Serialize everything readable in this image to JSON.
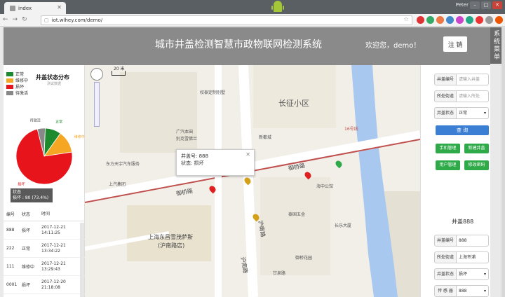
{
  "browser": {
    "tab_title": "index",
    "url": "iot.wlhey.com/demo/",
    "user": "Peter"
  },
  "header": {
    "title": "城市井盖检测智慧市政物联网检测系统",
    "welcome": "欢迎您，demo！",
    "logout_label": "注 销",
    "sys_menu": "系统菜单"
  },
  "status_chart": {
    "title": "井盖状态分布",
    "subtitle": "测试数据",
    "legend": [
      {
        "label": "正常",
        "color": "#1e8a2e"
      },
      {
        "label": "维修中",
        "color": "#f5a623"
      },
      {
        "label": "损坏",
        "color": "#e8141b"
      },
      {
        "label": "待激活",
        "color": "#888888"
      }
    ],
    "tooltip_title": "状态",
    "tooltip_value": "损坏 : 80 (73.4%)",
    "slice_labels": [
      "待激活",
      "正常",
      "维修中",
      "损坏"
    ]
  },
  "chart_data": {
    "type": "pie",
    "title": "井盖状态分布",
    "subtitle": "测试数据",
    "slices": [
      {
        "label": "损坏",
        "value": 73.4,
        "color": "#e8141b"
      },
      {
        "label": "维修中",
        "value": 12.8,
        "color": "#f5a623"
      },
      {
        "label": "正常",
        "value": 9.2,
        "color": "#1e8a2e"
      },
      {
        "label": "待激活",
        "value": 4.6,
        "color": "#888888"
      }
    ]
  },
  "table": {
    "headers": [
      "编号",
      "状态",
      "时间"
    ],
    "rows": [
      {
        "id": "888",
        "status": "损坏",
        "time1": "2017-12-21",
        "time2": "14:11:25"
      },
      {
        "id": "222",
        "status": "正常",
        "time1": "2017-12-21",
        "time2": "13:34:22"
      },
      {
        "id": "111",
        "status": "维修中",
        "time1": "2017-12-21",
        "time2": "13:29:43"
      },
      {
        "id": "0001",
        "status": "损坏",
        "time1": "2017-12-20",
        "time2": "21:18:08"
      }
    ]
  },
  "map": {
    "info_title": "井盖号: 888",
    "info_status": "状态: 损坏",
    "scale": "20 米",
    "labels": {
      "area1": "长征小区",
      "metro": "16号线",
      "road1": "御桥路",
      "road2": "御桥路",
      "road3": "沪南路",
      "road4": "沪南路",
      "place1": "上海东昌雪茂萨斯",
      "place2": "(沪南路店)",
      "poi1": "权泰定制别墅",
      "poi2": "广汽本田",
      "poi3": "东方天宇汽车服务",
      "poi4": "别克雪佛兰",
      "poi5": "新都城",
      "poi6": "上汽集团",
      "poi7": "泰国五金",
      "poi8": "海中公馆",
      "poi9": "御桥花园",
      "poi10": "长乐大厦",
      "poi11": "甘泉路"
    }
  },
  "search_form": {
    "fields": [
      {
        "label": "井盖编号",
        "placeholder": "请输入井盖"
      },
      {
        "label": "所处街道",
        "placeholder": "请输入所处"
      },
      {
        "label": "井盖状态",
        "value": "正常"
      }
    ],
    "query_label": "查 询",
    "btn_phone": "手机管理",
    "btn_new": "新建井盖",
    "btn_user": "用户管理",
    "btn_pwd": "修改密码"
  },
  "detail": {
    "title": "井盖888",
    "fields": [
      {
        "label": "井盖编号",
        "value": "888"
      },
      {
        "label": "所处街道",
        "value": "上海市浦"
      },
      {
        "label": "井盖状态",
        "value": "损坏"
      },
      {
        "label": "传 感 器",
        "value": "888"
      }
    ]
  }
}
